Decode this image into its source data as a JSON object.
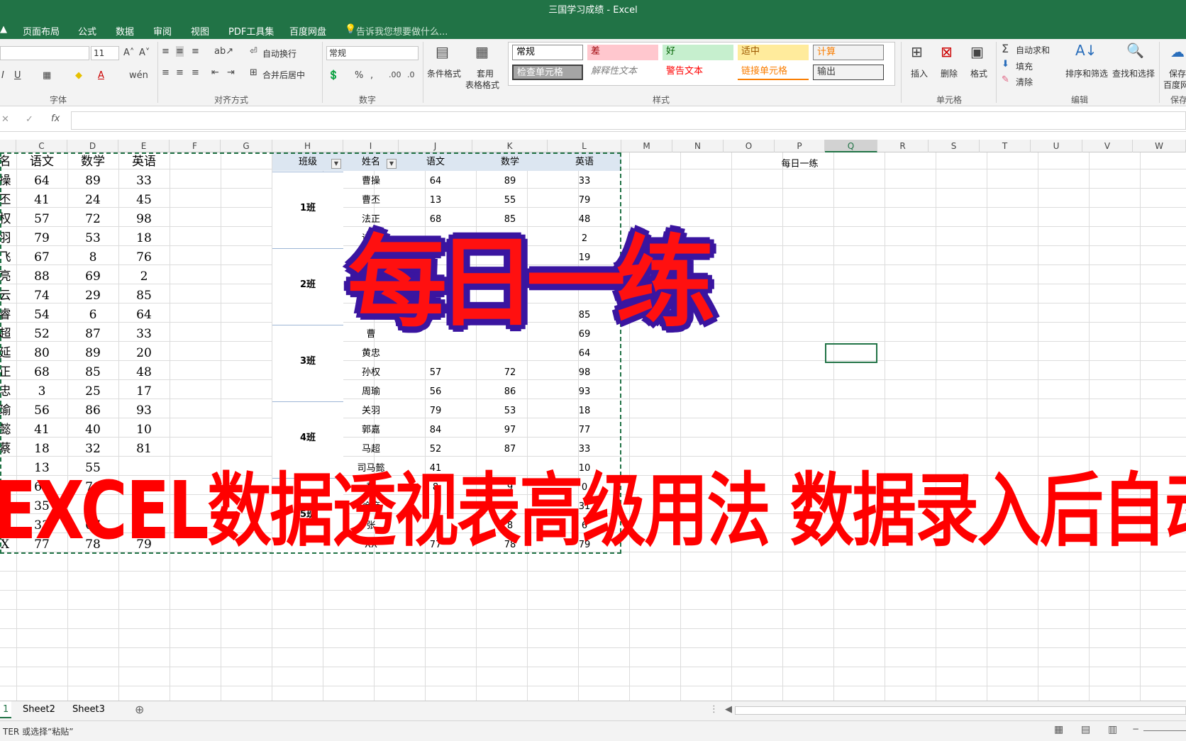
{
  "window": {
    "title": "三国学习成绩 - Excel"
  },
  "menu": {
    "tabs": [
      "页面布局",
      "公式",
      "数据",
      "审阅",
      "视图",
      "PDF工具集",
      "百度网盘"
    ],
    "tell_me": "告诉我您想要做什么..."
  },
  "ribbon": {
    "font_size": "11",
    "wrap_text": "自动换行",
    "merge_center": "合并后居中",
    "number_format": "常规",
    "conditional_format": "条件格式",
    "format_as_table_1": "套用",
    "format_as_table_2": "表格格式",
    "styles": [
      {
        "label": "常规",
        "bg": "#ffffff",
        "color": "#000000"
      },
      {
        "label": "差",
        "bg": "#ffc7ce",
        "color": "#9c0006"
      },
      {
        "label": "好",
        "bg": "#c6efce",
        "color": "#006100"
      },
      {
        "label": "适中",
        "bg": "#ffeb9c",
        "color": "#9c5700"
      },
      {
        "label": "计算",
        "bg": "#f2f2f2",
        "color": "#fa7d00"
      },
      {
        "label": "检查单元格",
        "bg": "#a5a5a5",
        "color": "#ffffff"
      },
      {
        "label": "解释性文本",
        "bg": "#ffffff",
        "color": "#7f7f7f"
      },
      {
        "label": "警告文本",
        "bg": "#ffffff",
        "color": "#ff0000"
      },
      {
        "label": "链接单元格",
        "bg": "#ffffff",
        "color": "#fa7d00"
      },
      {
        "label": "输出",
        "bg": "#f2f2f2",
        "color": "#3f3f3f"
      }
    ],
    "insert": "插入",
    "delete": "删除",
    "format": "格式",
    "autosum": "自动求和",
    "fill": "填充",
    "clear": "清除",
    "sort_filter": "排序和筛选",
    "find_select": "查找和选择",
    "save_to_baidu_1": "保存",
    "save_to_baidu_2": "百度网",
    "groups": [
      "字体",
      "对齐方式",
      "数字",
      "样式",
      "单元格",
      "编辑",
      "保存"
    ]
  },
  "formula_bar": {
    "fx": "fx",
    "content": ""
  },
  "columns": [
    "C",
    "D",
    "E",
    "F",
    "G",
    "H",
    "I",
    "J",
    "K",
    "L",
    "M",
    "N",
    "O",
    "P",
    "Q",
    "R",
    "S",
    "T",
    "U",
    "V",
    "W"
  ],
  "left_table": {
    "headers": [
      "名",
      "语文",
      "数学",
      "英语"
    ],
    "rows": [
      [
        "操",
        "64",
        "89",
        "33"
      ],
      [
        "丕",
        "41",
        "24",
        "45"
      ],
      [
        "权",
        "57",
        "72",
        "98"
      ],
      [
        "羽",
        "79",
        "53",
        "18"
      ],
      [
        "飞",
        "67",
        "8",
        "76"
      ],
      [
        "亮",
        "88",
        "69",
        "2"
      ],
      [
        "云",
        "74",
        "29",
        "85"
      ],
      [
        "睿",
        "54",
        "6",
        "64"
      ],
      [
        "超",
        "52",
        "87",
        "33"
      ],
      [
        "延",
        "80",
        "89",
        "20"
      ],
      [
        "正",
        "68",
        "85",
        "48"
      ],
      [
        "忠",
        "3",
        "25",
        "17"
      ],
      [
        "瑜",
        "56",
        "86",
        "93"
      ],
      [
        "懿",
        "41",
        "40",
        "10"
      ],
      [
        "蔡",
        "18",
        "32",
        "81"
      ],
      [
        "",
        "13",
        "55",
        ""
      ],
      [
        "",
        "63",
        "71",
        ""
      ],
      [
        "",
        "35",
        "2",
        ""
      ],
      [
        "",
        "33",
        "07",
        ""
      ],
      [
        "X",
        "77",
        "78",
        "79"
      ]
    ]
  },
  "pivot": {
    "headers": [
      "班级",
      "姓名",
      "语文",
      "数学",
      "英语"
    ],
    "groups": [
      "1班",
      "2班",
      "3班",
      "4班",
      "5班"
    ],
    "rows": [
      [
        "曹操",
        "64",
        "89",
        "33"
      ],
      [
        "曹丕",
        "13",
        "55",
        "79"
      ],
      [
        "法正",
        "68",
        "85",
        "48"
      ],
      [
        "诸葛",
        "",
        "",
        "2"
      ],
      [
        "",
        "",
        "",
        "19"
      ],
      [
        "",
        "",
        "",
        ""
      ],
      [
        "",
        "",
        "",
        ""
      ],
      [
        "",
        "",
        "",
        "85"
      ],
      [
        "曹",
        "",
        "",
        "69"
      ],
      [
        "黄忠",
        "",
        "",
        "64"
      ],
      [
        "孙权",
        "57",
        "72",
        "98"
      ],
      [
        "周瑜",
        "56",
        "86",
        "93"
      ],
      [
        "关羽",
        "79",
        "53",
        "18"
      ],
      [
        "郭嘉",
        "84",
        "97",
        "77"
      ],
      [
        "马超",
        "52",
        "87",
        "33"
      ],
      [
        "司马懿",
        "41",
        "",
        "10"
      ],
      [
        "魏",
        "8",
        "9",
        "0"
      ],
      [
        "徐庶",
        "",
        "",
        "31"
      ],
      [
        "张",
        "",
        "8",
        "6"
      ],
      [
        "XX",
        "77",
        "78",
        "79"
      ]
    ]
  },
  "side_note": "每日一练",
  "overlay": {
    "title": "每日一练",
    "subtitle": "EXCEL数据透视表高级用法 数据录入后自动汇总"
  },
  "sheets": [
    "1",
    "Sheet2",
    "Sheet3"
  ],
  "status": {
    "text": "TER 或选择“粘贴”"
  }
}
